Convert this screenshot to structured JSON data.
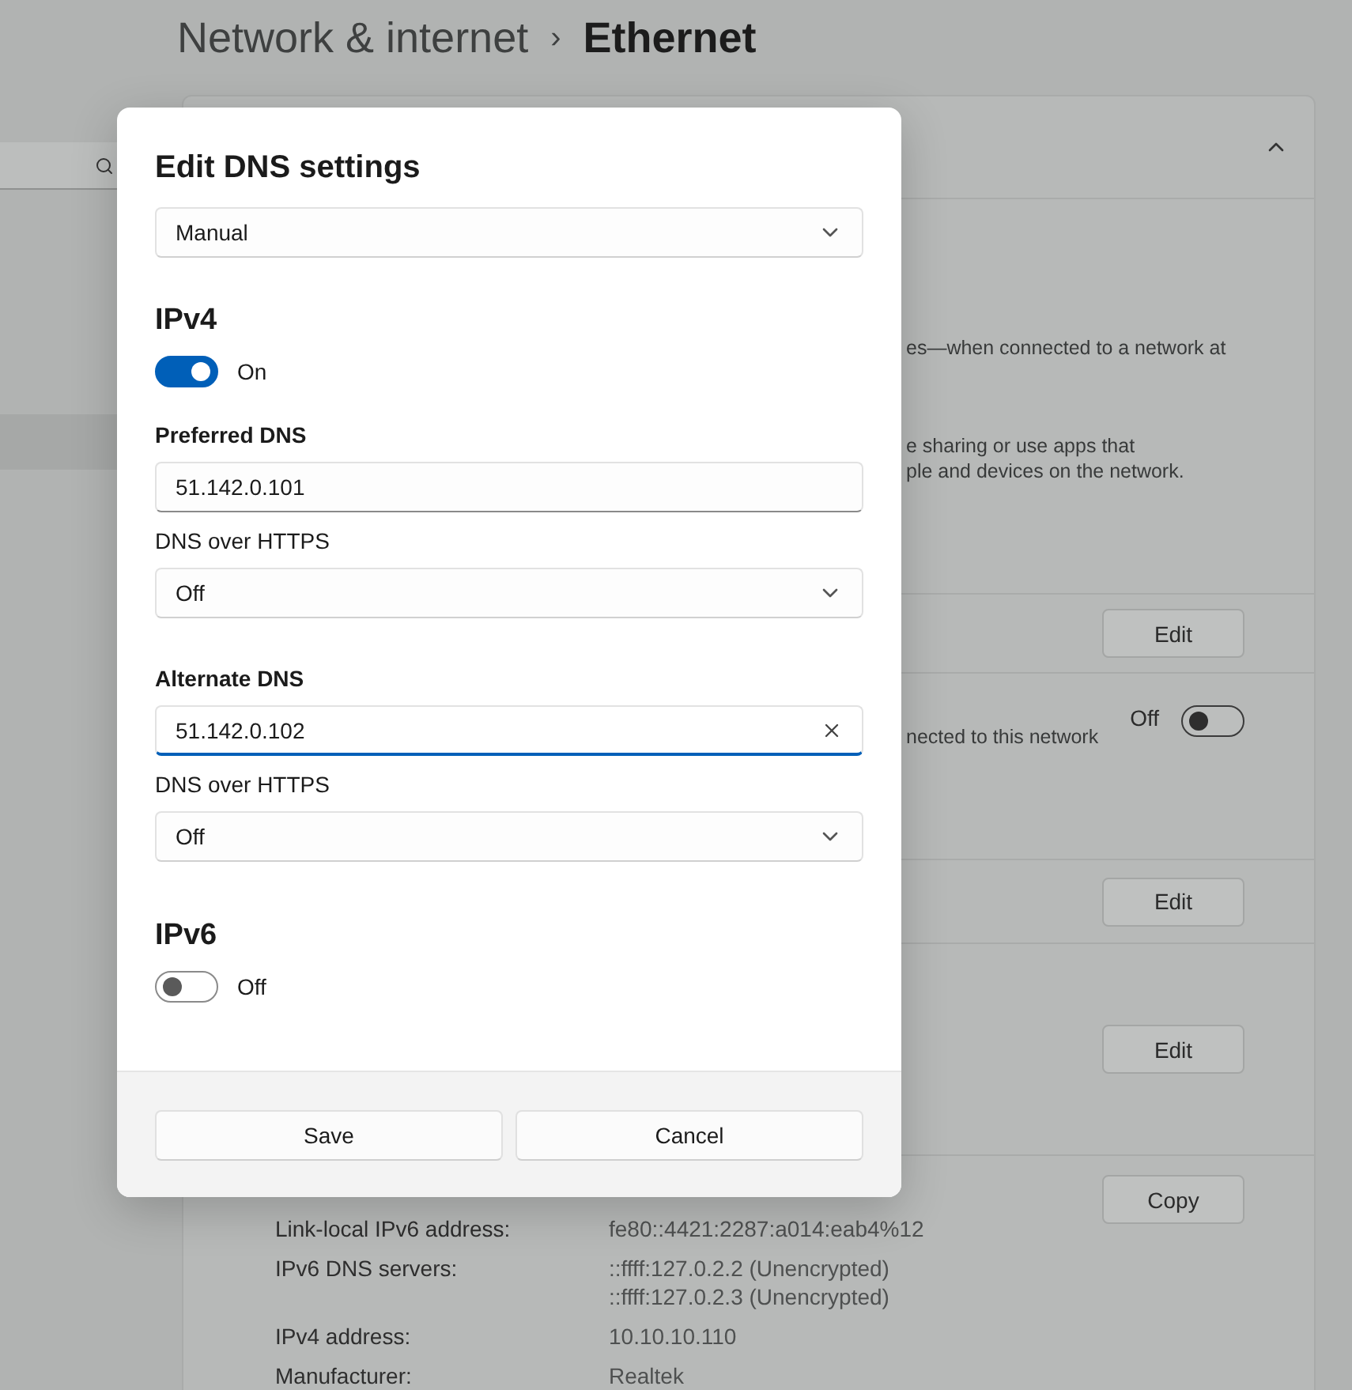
{
  "settings_page": {
    "breadcrumb": {
      "parent": "Network & internet",
      "separator": "›",
      "current": "Ethernet"
    },
    "description": [
      "es—when connected to a network at",
      "e sharing or use apps that\nple and devices on the network."
    ],
    "rows": [
      {
        "kind": "button",
        "label": "Edit"
      },
      {
        "kind": "toggle",
        "text": "nected to this network",
        "state_label": "Off",
        "on": false
      },
      {
        "kind": "button",
        "label": "Edit"
      },
      {
        "kind": "button",
        "label": "Edit"
      }
    ],
    "copy_button": "Copy",
    "properties": [
      {
        "name": "Link-local IPv6 address:",
        "values": [
          "fe80::4421:2287:a014:eab4%12"
        ]
      },
      {
        "name": "IPv6 DNS servers:",
        "values": [
          "::ffff:127.0.2.2 (Unencrypted)",
          "::ffff:127.0.2.3 (Unencrypted)"
        ]
      },
      {
        "name": "IPv4 address:",
        "values": [
          "10.10.10.110"
        ]
      },
      {
        "name": "Manufacturer:",
        "values": [
          "Realtek"
        ]
      }
    ]
  },
  "dialog": {
    "title": "Edit DNS settings",
    "mode": "Manual",
    "sections": [
      {
        "heading": "IPv4",
        "on": true,
        "state_label": "On",
        "entries": [
          {
            "label": "Preferred DNS",
            "value": "51.142.0.101",
            "focused": false,
            "https_label": "DNS over HTTPS",
            "https": "Off"
          },
          {
            "label": "Alternate DNS",
            "value": "51.142.0.102",
            "focused": true,
            "https_label": "DNS over HTTPS",
            "https": "Off"
          }
        ]
      },
      {
        "heading": "IPv6",
        "on": false,
        "state_label": "Off"
      }
    ],
    "buttons": [
      "Save",
      "Cancel"
    ]
  }
}
